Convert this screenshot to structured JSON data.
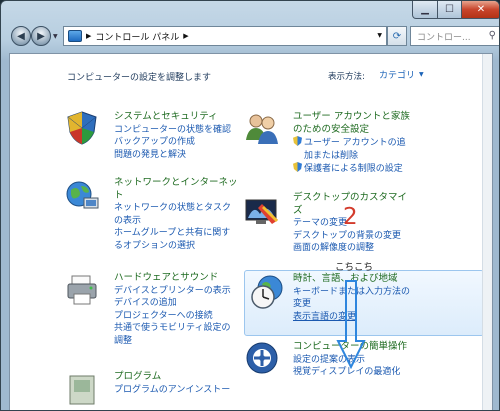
{
  "window": {
    "address": {
      "root_label": "コントロール パネル"
    },
    "search_placeholder": "コントロー..."
  },
  "content": {
    "heading": "コンピューターの設定を調整します",
    "view_by_label": "表示方法:",
    "view_by_value": "カテゴリ"
  },
  "categories": {
    "system": {
      "title": "システムとセキュリティ",
      "links": [
        "コンピューターの状態を確認",
        "バックアップの作成",
        "問題の発見と解決"
      ]
    },
    "network": {
      "title": "ネットワークとインターネッ",
      "title2": "ト",
      "links": [
        "ネットワークの状態とタスク",
        "の表示",
        "ホームグループと共有に関す",
        "るオプションの選択"
      ]
    },
    "hardware": {
      "title": "ハードウェアとサウンド",
      "links": [
        "デバイスとプリンターの表示",
        "デバイスの追加",
        "プロジェクターへの接続",
        "共通で使うモビリティ設定の",
        "調整"
      ]
    },
    "programs": {
      "title": "プログラム",
      "links": [
        "プログラムのアンインストー"
      ]
    },
    "users": {
      "title": "ユーザー アカウントと家族",
      "title2": "のための安全設定",
      "links": [
        "ユーザー アカウントの追",
        "加または削除",
        "保護者による制限の設定"
      ]
    },
    "appearance": {
      "title": "デスクトップのカスタマイ",
      "title2": "ズ",
      "links": [
        "テーマの変更",
        "デスクトップの背景の変更",
        "画面の解像度の調整"
      ]
    },
    "clock": {
      "title": "時計、言語、および地域",
      "links": [
        "キーボードまたは入力方法の",
        "変更",
        "表示言語の変更"
      ]
    },
    "ease": {
      "title": "コンピューターの簡単操作",
      "links": [
        "設定の提案の表示",
        "視覚ディスプレイの最適化"
      ]
    }
  },
  "annotation": {
    "number": "2",
    "text": "こちこち"
  },
  "colors": {
    "title_green": "#1f6b21",
    "link_blue": "#1b59b0",
    "annotation_red": "#d33b2c",
    "arrow_blue": "#2e86de"
  }
}
